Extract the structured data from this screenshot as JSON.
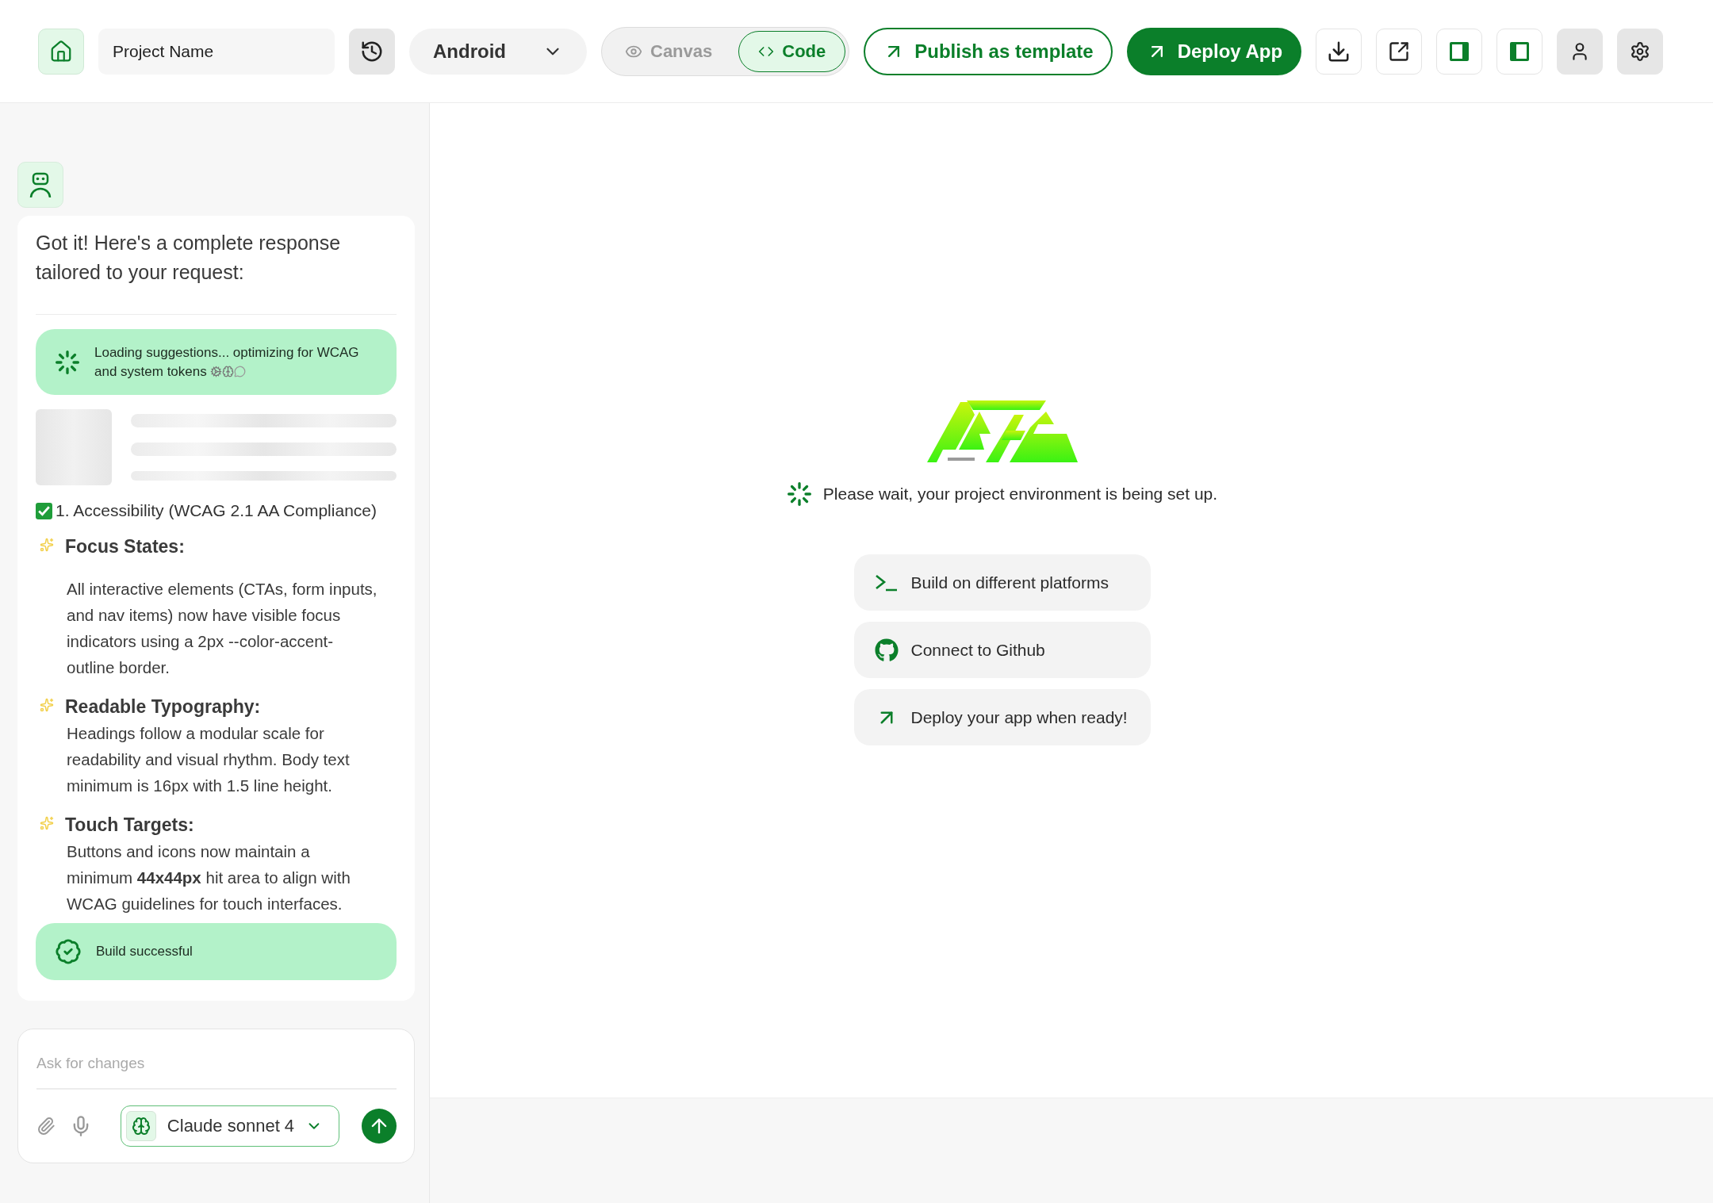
{
  "topbar": {
    "project_name": "Project Name",
    "platform": "Android",
    "view_modes": [
      {
        "kind": "canvas",
        "label": "Canvas",
        "selected": false
      },
      {
        "kind": "code",
        "label": "Code",
        "selected": true
      }
    ],
    "publish_button": "Publish as template",
    "deploy_button": "Deploy App"
  },
  "chat": {
    "intro": "Got it! Here's a complete response tailored to your request:",
    "loading_status": "Loading suggestions... optimizing for WCAG and system tokens",
    "section_title": "1. Accessibility (WCAG 2.1 AA Compliance)",
    "items": [
      {
        "title": "Focus States:",
        "text": "All interactive elements (CTAs, form inputs, and nav items) now have visible focus indicators using a 2px --color-accent-outline border."
      },
      {
        "title": "Readable Typography:",
        "text": "Headings follow a modular scale for readability and visual rhythm. Body text minimum is 16px with 1.5 line height."
      },
      {
        "title": "Touch Targets:",
        "text": "Buttons and icons now maintain a minimum **44x44px** hit area to align with WCAG guidelines for touch interfaces."
      }
    ],
    "build_status": "Build successful"
  },
  "composer": {
    "placeholder": "Ask for changes",
    "model": "Claude sonnet 4"
  },
  "workspace": {
    "status": "Please wait, your project environment is being set up.",
    "actions": [
      {
        "kind": "terminal",
        "label": "Build on different platforms"
      },
      {
        "kind": "github",
        "label": "Connect to Github"
      },
      {
        "kind": "deploy",
        "label": "Deploy your app when ready!"
      }
    ]
  }
}
